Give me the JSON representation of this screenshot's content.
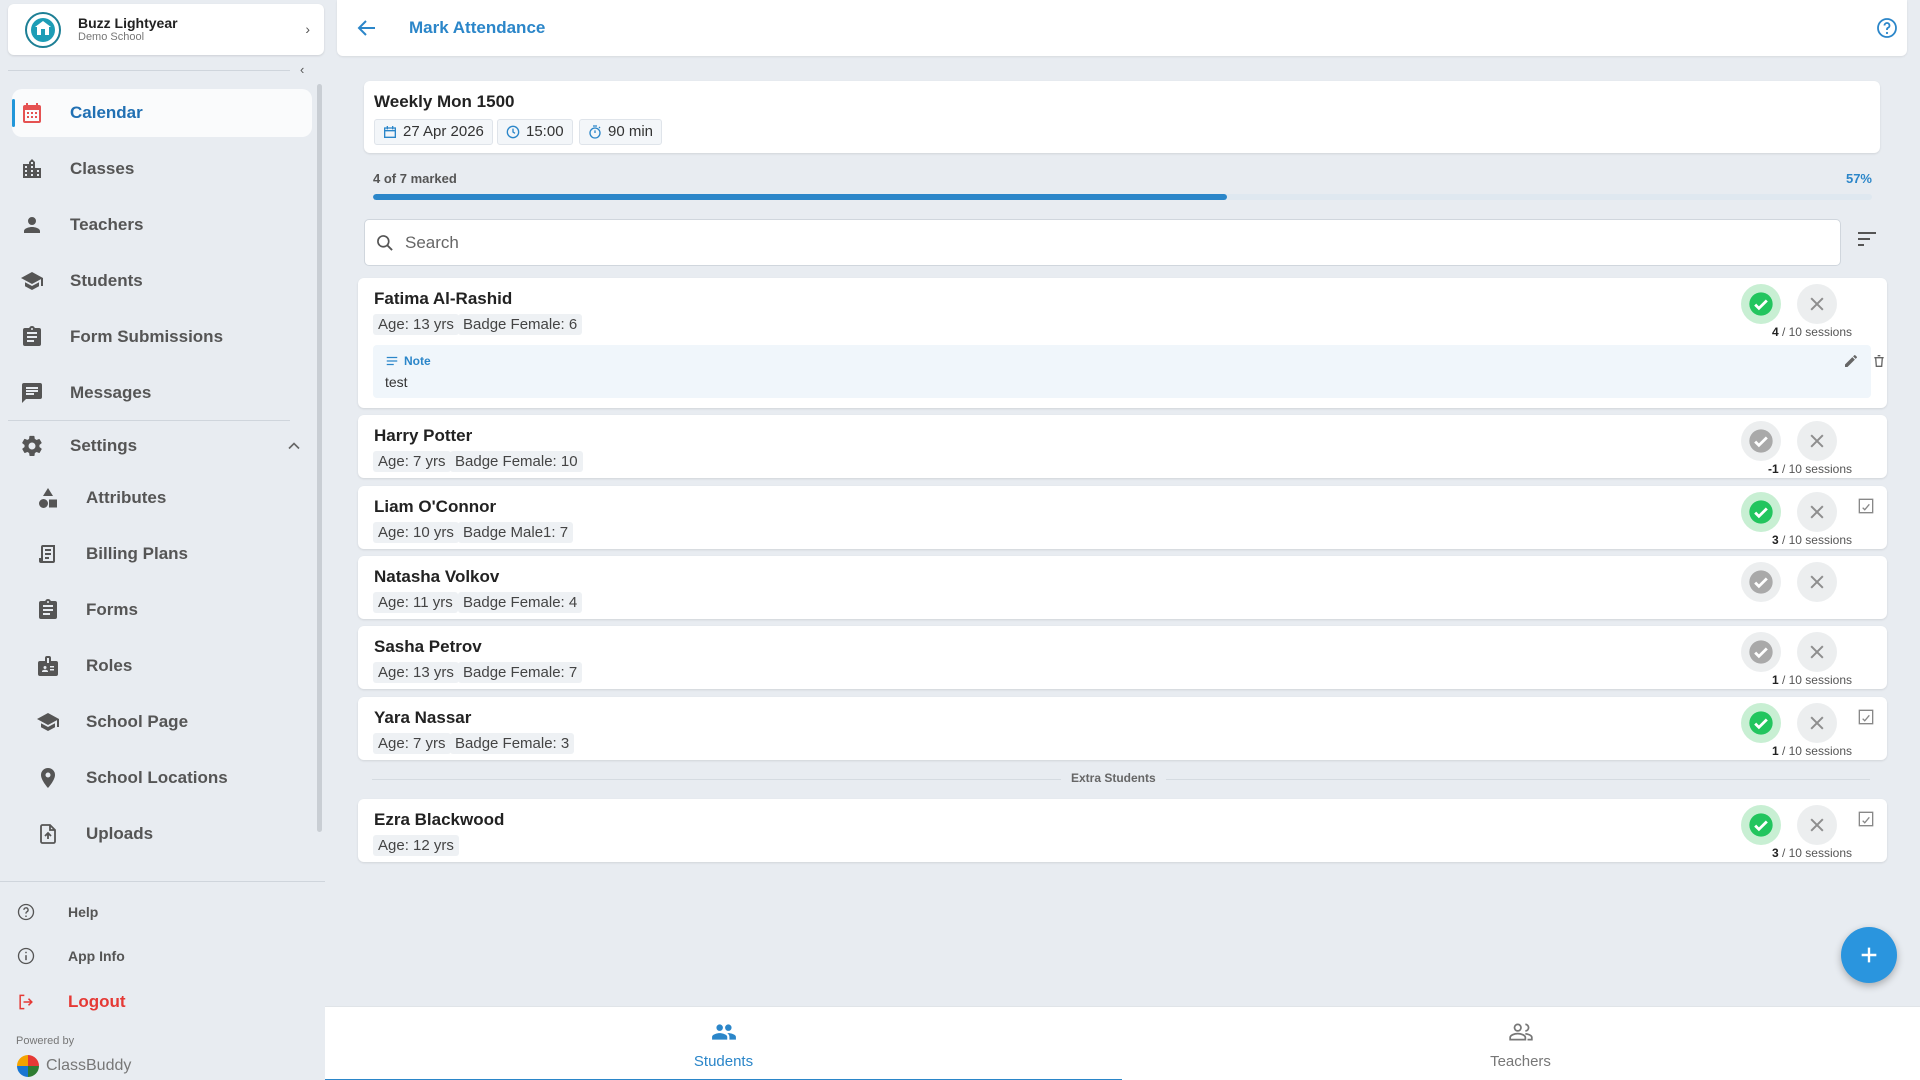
{
  "profile": {
    "name": "Buzz Lightyear",
    "school": "Demo School"
  },
  "sidebar": {
    "items": [
      {
        "label": "Calendar"
      },
      {
        "label": "Classes"
      },
      {
        "label": "Teachers"
      },
      {
        "label": "Students"
      },
      {
        "label": "Form Submissions"
      },
      {
        "label": "Messages"
      },
      {
        "label": "Settings"
      },
      {
        "label": "Attributes"
      },
      {
        "label": "Billing Plans"
      },
      {
        "label": "Forms"
      },
      {
        "label": "Roles"
      },
      {
        "label": "School Page"
      },
      {
        "label": "School Locations"
      },
      {
        "label": "Uploads"
      }
    ],
    "footer": {
      "help": "Help",
      "app_info": "App Info",
      "logout": "Logout",
      "powered_by": "Powered by",
      "brand": "ClassBuddy"
    }
  },
  "header": {
    "title": "Mark Attendance"
  },
  "class_info": {
    "name": "Weekly Mon 1500",
    "date": "27 Apr 2026",
    "time": "15:00",
    "duration": "90 min"
  },
  "progress": {
    "label": "4 of 7 marked",
    "percent_label": "57%",
    "fraction": 0.57
  },
  "search": {
    "placeholder": "Search"
  },
  "students": [
    {
      "name": "Fatima Al-Rashid",
      "age": "Age: 13 yrs",
      "badge": "Badge Female: 6",
      "sessions_used": "4",
      "sessions_total": " / 10 sessions",
      "note_label": "Note",
      "note_text": "test"
    },
    {
      "name": "Harry Potter",
      "age": "Age: 7 yrs",
      "badge": "Badge Female: 10",
      "sessions_used": "-1",
      "sessions_total": " / 10 sessions"
    },
    {
      "name": "Liam O'Connor",
      "age": "Age: 10 yrs",
      "badge": "Badge Male1: 7",
      "sessions_used": "3",
      "sessions_total": " / 10 sessions"
    },
    {
      "name": "Natasha Volkov",
      "age": "Age: 11 yrs",
      "badge": "Badge Female: 4"
    },
    {
      "name": "Sasha Petrov",
      "age": "Age: 13 yrs",
      "badge": "Badge Female: 7",
      "sessions_used": "1",
      "sessions_total": " / 10 sessions"
    },
    {
      "name": "Yara Nassar",
      "age": "Age: 7 yrs",
      "badge": "Badge Female: 3",
      "sessions_used": "1",
      "sessions_total": " / 10 sessions"
    }
  ],
  "extra_section": {
    "label": "Extra Students"
  },
  "extra_students": [
    {
      "name": "Ezra Blackwood",
      "age": "Age: 12 yrs",
      "sessions_used": "3",
      "sessions_total": " / 10 sessions"
    }
  ],
  "bottom_nav": {
    "students": "Students",
    "teachers": "Teachers"
  },
  "icons": {
    "calendar": "calendar-icon",
    "classes": "building-icon",
    "teachers": "person-icon",
    "students": "school-icon",
    "forms": "clipboard-icon",
    "messages": "chat-icon",
    "settings": "gear-icon",
    "attributes": "shapes-icon",
    "billing": "receipt-icon",
    "roles": "id-badge-icon",
    "location": "pin-icon",
    "uploads": "upload-file-icon"
  },
  "colors": {
    "accent": "#2b86c9",
    "present": "#22c55e",
    "logout": "#e53935",
    "calendar_icon": "#e55252"
  }
}
